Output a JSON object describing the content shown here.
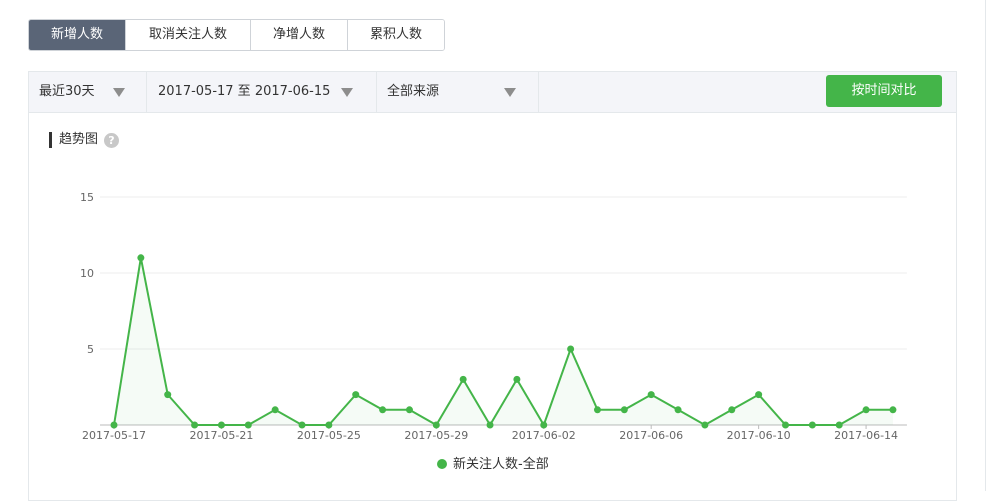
{
  "tabs": [
    {
      "label": "新增人数",
      "active": true
    },
    {
      "label": "取消关注人数",
      "active": false
    },
    {
      "label": "净增人数",
      "active": false
    },
    {
      "label": "累积人数",
      "active": false
    }
  ],
  "filters": {
    "period": "最近30天",
    "date_range": "2017-05-17 至 2017-06-15",
    "source": "全部来源"
  },
  "compare_button": "按时间对比",
  "trend": {
    "title": "趋势图",
    "help_icon": "question-icon"
  },
  "colors": {
    "accent": "#44b549",
    "tab_active": "#5a6577"
  },
  "chart_data": {
    "type": "line",
    "x": [
      "2017-05-17",
      "2017-05-18",
      "2017-05-19",
      "2017-05-20",
      "2017-05-21",
      "2017-05-22",
      "2017-05-23",
      "2017-05-24",
      "2017-05-25",
      "2017-05-26",
      "2017-05-27",
      "2017-05-28",
      "2017-05-29",
      "2017-05-30",
      "2017-05-31",
      "2017-06-01",
      "2017-06-02",
      "2017-06-03",
      "2017-06-04",
      "2017-06-05",
      "2017-06-06",
      "2017-06-07",
      "2017-06-08",
      "2017-06-09",
      "2017-06-10",
      "2017-06-11",
      "2017-06-12",
      "2017-06-13",
      "2017-06-14",
      "2017-06-15"
    ],
    "series": [
      {
        "name": "新关注人数-全部",
        "color": "#44b549",
        "values": [
          0,
          11,
          2,
          0,
          0,
          0,
          1,
          0,
          0,
          2,
          1,
          1,
          0,
          3,
          0,
          3,
          0,
          5,
          1,
          1,
          2,
          1,
          0,
          1,
          2,
          0,
          0,
          0,
          1,
          1
        ]
      }
    ],
    "x_tick_labels": [
      "2017-05-17",
      "2017-05-21",
      "2017-05-25",
      "2017-05-29",
      "2017-06-02",
      "2017-06-06",
      "2017-06-10",
      "2017-06-14"
    ],
    "y_ticks": [
      5,
      10,
      15
    ],
    "ylim": [
      0,
      15
    ],
    "grid": true,
    "legend_position": "bottom-center"
  }
}
